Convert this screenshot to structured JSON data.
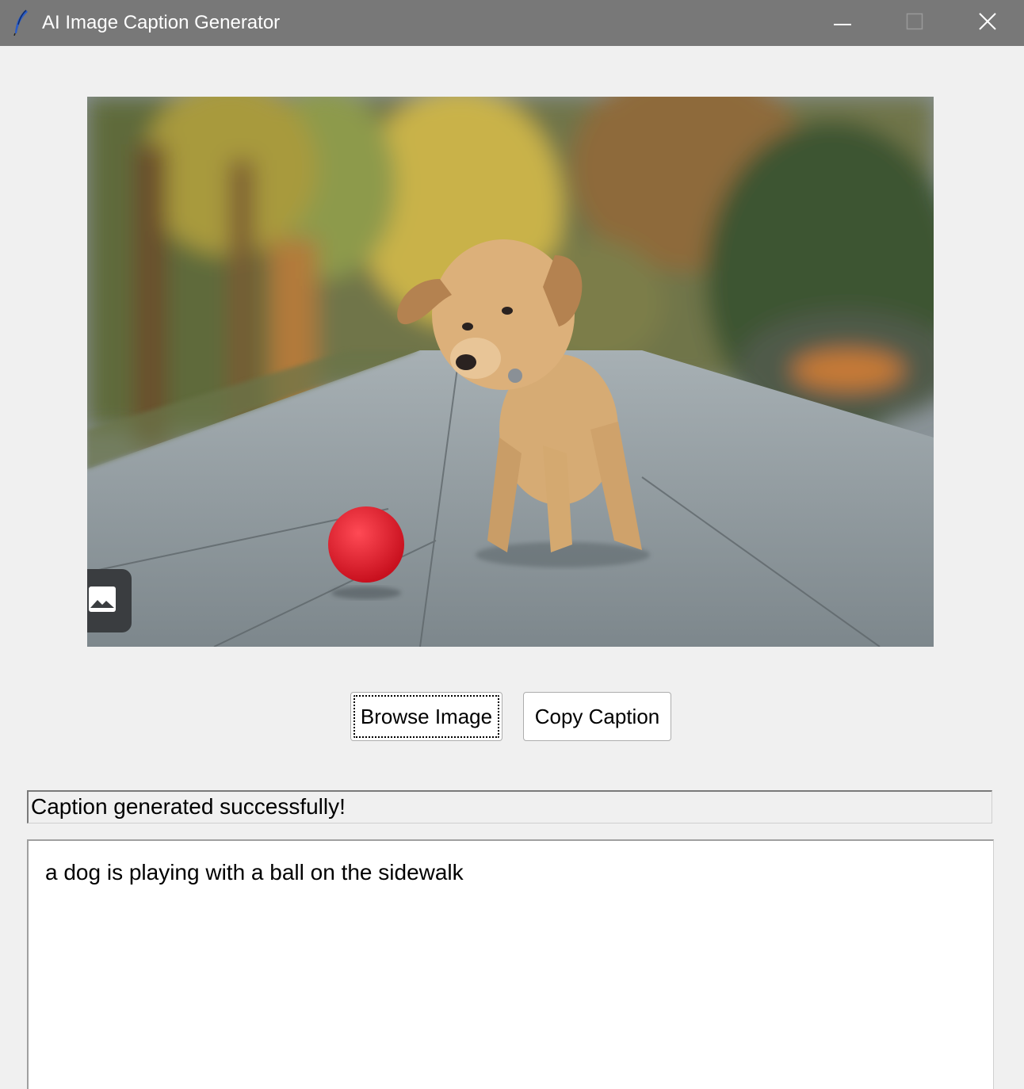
{
  "window": {
    "title": "AI Image Caption Generator",
    "app_icon": "feather-icon",
    "controls": [
      "minimize-icon",
      "maximize-icon",
      "close-icon"
    ]
  },
  "image_panel": {
    "badge_icon": "image-icon"
  },
  "buttons": {
    "browse_label": "Browse Image",
    "copy_label": "Copy Caption"
  },
  "status": {
    "text": "Caption generated successfully!"
  },
  "caption": {
    "text": "a dog is playing with a ball on the sidewalk"
  },
  "colors": {
    "titlebar": "#787878",
    "window_bg": "#f0f0f0",
    "button_bg": "#ffffff",
    "textbox_bg": "#ffffff"
  }
}
